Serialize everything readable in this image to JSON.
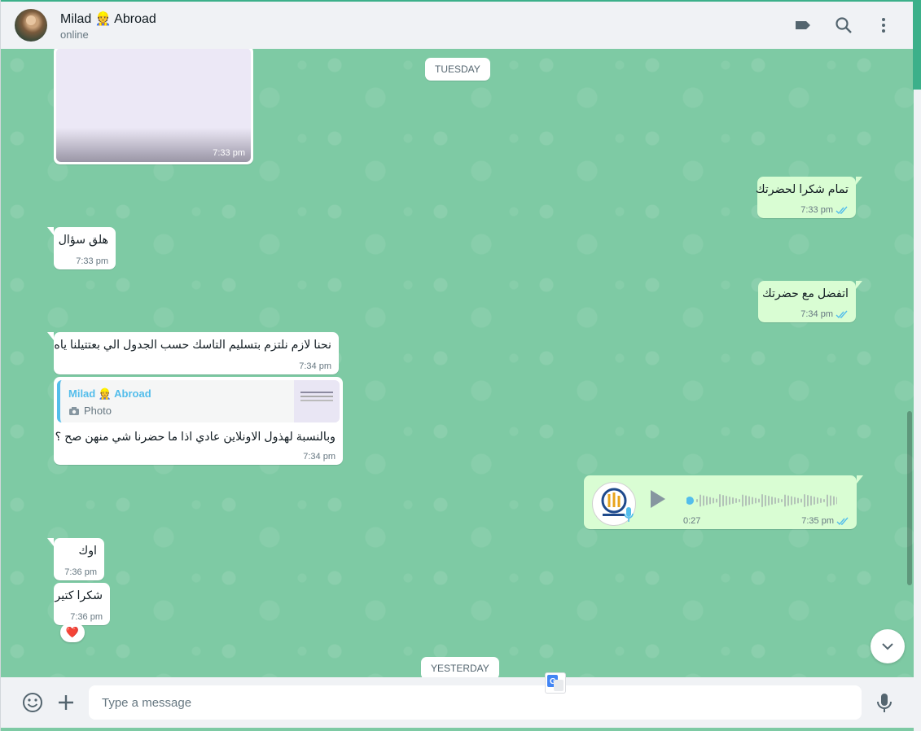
{
  "header": {
    "contact_name": "Milad 👷 Abroad",
    "status": "online"
  },
  "dates": {
    "tuesday": "TUESDAY",
    "yesterday": "YESTERDAY"
  },
  "messages": [
    {
      "id": "img",
      "direction": "in",
      "time": "7:33 pm"
    },
    {
      "id": "m1",
      "direction": "out",
      "text": "تمام شكرا لحضرتك",
      "time": "7:33 pm"
    },
    {
      "id": "m2",
      "direction": "in",
      "text": "هلق سؤال",
      "time": "7:33 pm"
    },
    {
      "id": "m3",
      "direction": "out",
      "text": "اتفضل مع حضرتك",
      "time": "7:34 pm"
    },
    {
      "id": "m4",
      "direction": "in",
      "text": "نحنا لازم نلتزم بتسليم التاسك حسب الجدول الي بعتتيلنا ياه",
      "time": "7:34 pm"
    },
    {
      "id": "m5",
      "direction": "in",
      "reply_name": "Milad 👷 Abroad",
      "reply_type": "Photo",
      "text": "وبالنسبة لهذول الاونلاين عادي اذا ما حضرنا شي منهن صح ؟",
      "time": "7:34 pm"
    },
    {
      "id": "m6",
      "direction": "out",
      "voice_duration": "0:27",
      "time": "7:35 pm"
    },
    {
      "id": "m7",
      "direction": "in",
      "text": "اوك",
      "time": "7:36 pm"
    },
    {
      "id": "m8",
      "direction": "in",
      "text": "شكرا كتير",
      "time": "7:36 pm",
      "reaction": "❤️"
    }
  ],
  "composer": {
    "placeholder": "Type a message"
  },
  "colors": {
    "chat_bg": "#7ecaa4",
    "outgoing": "#d9fdd3",
    "incoming": "#ffffff",
    "accent": "#53bdeb"
  },
  "icons": [
    "label-icon",
    "search-icon",
    "menu-icon",
    "emoji-icon",
    "attach-icon",
    "mic-icon",
    "chevron-down-icon",
    "translate-icon",
    "read-ticks-icon",
    "camera-icon",
    "play-icon"
  ]
}
